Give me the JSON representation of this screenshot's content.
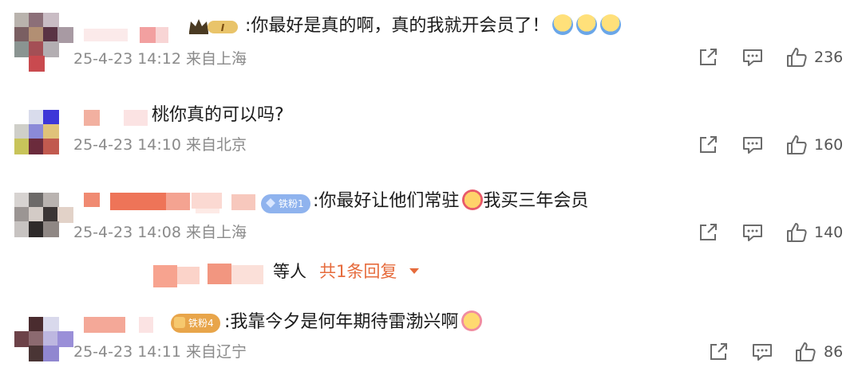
{
  "comments": [
    {
      "text": ":你最好是真的啊，真的我就开会员了！",
      "meta": "25-4-23 14:12 来自上海",
      "likes": "236",
      "badge": "I"
    },
    {
      "text": "桃你真的可以吗?",
      "meta": "25-4-23 14:10 来自北京",
      "likes": "160"
    },
    {
      "text": ":你最好让他们常驻",
      "text_after_emoji": "我买三年会员",
      "meta": "25-4-23 14:08 来自上海",
      "likes": "140",
      "badge": "铁粉1"
    },
    {
      "text": ":我靠今夕是何年期待雷渤兴啊",
      "meta": "25-4-23 14:11 来自辽宁",
      "likes": "86",
      "badge": "铁粉4"
    }
  ],
  "reply": {
    "prefix": "等人",
    "link": "共1条回复",
    "link_color": "#e66b3c"
  },
  "colors": {
    "meta": "#8a8a8a",
    "icon": "#6b6b6b",
    "badge_blue": "#7ea7e6",
    "badge_orange": "#f0a04b"
  },
  "icons": [
    "share-icon",
    "comment-icon",
    "like-icon",
    "chevron-down-icon",
    "crown-icon",
    "diamond-icon"
  ]
}
